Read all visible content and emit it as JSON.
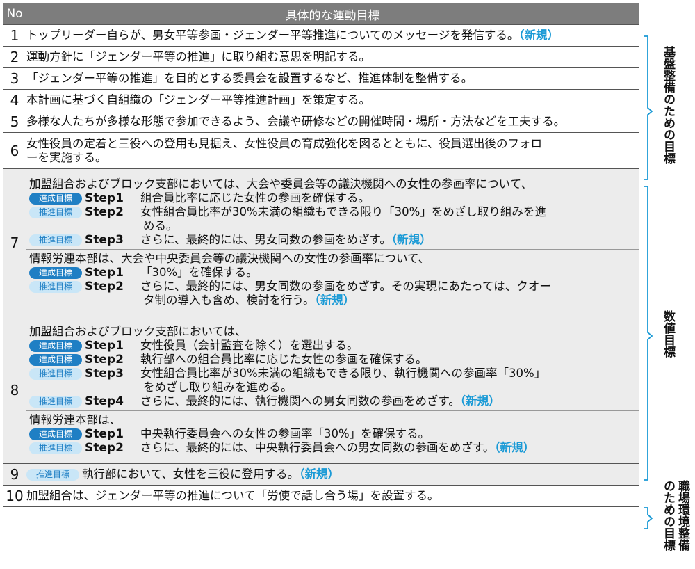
{
  "header": {
    "no": "No",
    "title": "具体的な運動目標"
  },
  "rows": [
    {
      "no": "1",
      "text": "トップリーダー自らが、男女平等参画・ジェンダー平等推進についてのメッセージを発信する。",
      "new": "（新規）"
    },
    {
      "no": "2",
      "text": "運動方針に「ジェンダー平等の推進」に取り組む意思を明記する。"
    },
    {
      "no": "3",
      "text": "「ジェンダー平等の推進」を目的とする委員会を設置するなど、推進体制を整備する。"
    },
    {
      "no": "4",
      "text": "本計画に基づく自組織の「ジェンダー平等推進計画」を策定する。"
    },
    {
      "no": "5",
      "text": "多様な人たちが多様な形態で参加できるよう、会議や研修などの開催時間・場所・方法などを工夫する。"
    },
    {
      "no": "6",
      "text_l1": "女性役員の定着と三役への登用も見据え、女性役員の育成強化を図るとともに、役員選出後のフォロ",
      "text_l2": "ーを実施する。"
    },
    {
      "no": "7",
      "a_intro": "加盟組合およびブロック支部においては、大会や委員会等の議決機関への女性の参画率について、",
      "a_s1": "組合員比率に応じた女性の参画を確保する。",
      "a_s2_l1": "女性組合員比率が30%未満の組織もできる限り「30%」をめざし取り組みを進",
      "a_s2_l2": "める。",
      "a_s3": "さらに、最終的には、男女同数の参画をめざす。",
      "b_intro": "情報労連本部は、大会や中央委員会等の議決機関への女性の参画率について、",
      "b_s1": "「30%」を確保する。",
      "b_s2_l1": "さらに、最終的には、男女同数の参画をめざす。その実現にあたっては、クオー",
      "b_s2_l2": "タ制の導入も含め、検討を行う。"
    },
    {
      "no": "8",
      "a_intro": "加盟組合およびブロック支部においては、",
      "a_s1": "女性役員（会計監査を除く）を選出する。",
      "a_s2": "執行部への組合員比率に応じた女性の参画を確保する。",
      "a_s3_l1": "女性組合員比率が30%未満の組織もできる限り、執行機関への参画率「30%」",
      "a_s3_l2": "をめざし取り組みを進める。",
      "a_s4": "さらに、最終的には、執行機関への男女同数の参画をめざす。",
      "b_intro": "情報労連本部は、",
      "b_s1": "中央執行委員会への女性の参画率「30%」を確保する。",
      "b_s2": "さらに、最終的には、中央執行委員会への男女同数の参画をめざす。"
    },
    {
      "no": "9",
      "text": "執行部において、女性を三役に登用する。"
    },
    {
      "no": "10",
      "text": "加盟組合は、ジェンダー平等の推進について「労使で話し合う場」を設置する。"
    }
  ],
  "labels": {
    "achieve": "達成目標",
    "promote": "推進目標",
    "step1": "Step1",
    "step2": "Step2",
    "step3": "Step3",
    "step4": "Step4",
    "new": "（新規）"
  },
  "side": {
    "base": "基盤整備のための目標",
    "numeric": "数値目標",
    "workplace_l1": "職場環境整備",
    "workplace_l2": "のための目標"
  },
  "colors": {
    "header": "#7d7d7d",
    "achieve": "#1f7fc4",
    "promote": "#c9e6f7",
    "new": "#1a9ad6"
  }
}
